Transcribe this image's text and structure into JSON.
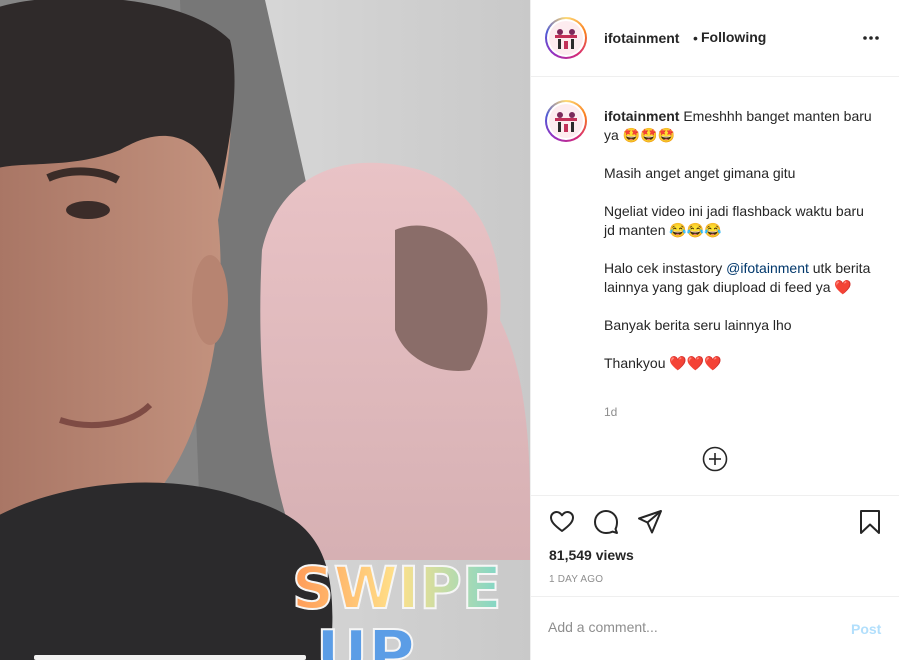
{
  "media": {
    "sticker_line1": "SWIPE",
    "sticker_line2": "UP"
  },
  "header": {
    "username": "ifotainment",
    "separator": "•",
    "follow_state": "Following",
    "more_icon": "more-horizontal-icon"
  },
  "caption": {
    "username": "ifotainment",
    "first_line": " Emeshhh banget manten baru ya 🤩🤩🤩",
    "paragraphs": [
      "Masih anget anget gimana gitu",
      "Ngeliat video ini jadi flashback waktu baru jd manten 😂😂😂"
    ],
    "mention_before": "Halo cek instastory ",
    "mention": "@ifotainment",
    "mention_after": " utk berita lainnya yang gak diupload di feed ya ❤️",
    "closing": [
      "Banyak berita seru lainnya lho",
      "Thankyou ❤️❤️❤️"
    ],
    "time": "1d"
  },
  "actions": {
    "icons": [
      "heart-icon",
      "comment-icon",
      "share-icon",
      "bookmark-icon"
    ],
    "views": "81,549 views",
    "posted": "1 DAY AGO"
  },
  "comment_box": {
    "placeholder": "Add a comment...",
    "post_label": "Post"
  },
  "colors": {
    "link": "#00376b",
    "post_disabled": "#b2dffc",
    "muted": "#8e8e8e"
  }
}
